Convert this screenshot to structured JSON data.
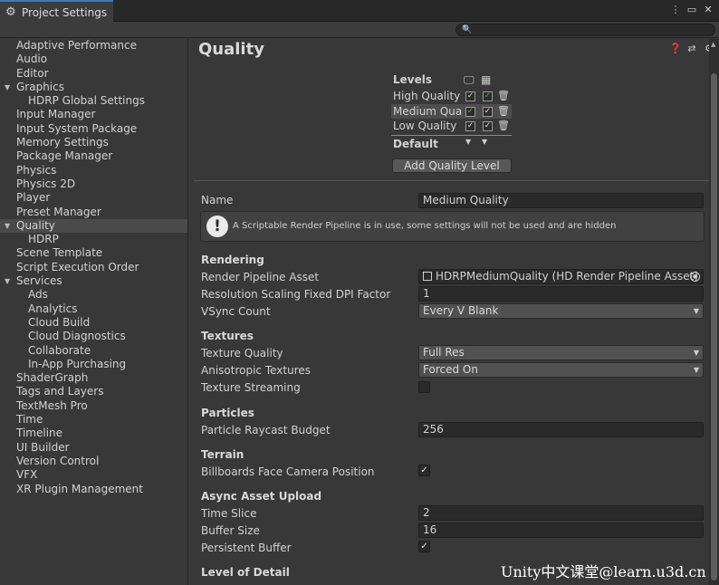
{
  "window": {
    "tab_icon": "gear-icon",
    "tab_title": "Project Settings",
    "buttons": [
      "more-icon",
      "maximize-icon",
      "close-icon"
    ]
  },
  "search": {
    "placeholder": ""
  },
  "sidebar": {
    "items": [
      {
        "label": "Adaptive Performance",
        "level": 0
      },
      {
        "label": "Audio",
        "level": 0
      },
      {
        "label": "Editor",
        "level": 0
      },
      {
        "label": "Graphics",
        "level": 0,
        "expanded": true
      },
      {
        "label": "HDRP Global Settings",
        "level": 1
      },
      {
        "label": "Input Manager",
        "level": 0
      },
      {
        "label": "Input System Package",
        "level": 0
      },
      {
        "label": "Memory Settings",
        "level": 0
      },
      {
        "label": "Package Manager",
        "level": 0
      },
      {
        "label": "Physics",
        "level": 0
      },
      {
        "label": "Physics 2D",
        "level": 0
      },
      {
        "label": "Player",
        "level": 0
      },
      {
        "label": "Preset Manager",
        "level": 0
      },
      {
        "label": "Quality",
        "level": 0,
        "expanded": true,
        "selected": true
      },
      {
        "label": "HDRP",
        "level": 1
      },
      {
        "label": "Scene Template",
        "level": 0
      },
      {
        "label": "Script Execution Order",
        "level": 0
      },
      {
        "label": "Services",
        "level": 0,
        "expanded": true
      },
      {
        "label": "Ads",
        "level": 1
      },
      {
        "label": "Analytics",
        "level": 1
      },
      {
        "label": "Cloud Build",
        "level": 1
      },
      {
        "label": "Cloud Diagnostics",
        "level": 1
      },
      {
        "label": "Collaborate",
        "level": 1
      },
      {
        "label": "In-App Purchasing",
        "level": 1
      },
      {
        "label": "ShaderGraph",
        "level": 0
      },
      {
        "label": "Tags and Layers",
        "level": 0
      },
      {
        "label": "TextMesh Pro",
        "level": 0
      },
      {
        "label": "Time",
        "level": 0
      },
      {
        "label": "Timeline",
        "level": 0
      },
      {
        "label": "UI Builder",
        "level": 0
      },
      {
        "label": "Version Control",
        "level": 0
      },
      {
        "label": "VFX",
        "level": 0
      },
      {
        "label": "XR Plugin Management",
        "level": 0
      }
    ]
  },
  "main": {
    "title": "Quality",
    "header_icons": [
      "help-icon",
      "preset-icon",
      "settings-icon"
    ],
    "levels": {
      "label": "Levels",
      "rows": [
        {
          "name": "High Quality",
          "desktop": true,
          "desktop_green": false,
          "standalone": true,
          "standalone_green": true
        },
        {
          "name": "Medium Quality",
          "desktop": true,
          "desktop_green": true,
          "standalone": true,
          "standalone_green": false,
          "selected": true
        },
        {
          "name": "Low Quality",
          "desktop": true,
          "desktop_green": false,
          "standalone": true,
          "standalone_green": false
        }
      ],
      "default_label": "Default"
    },
    "add_button": "Add Quality Level",
    "name_label": "Name",
    "name_value": "Medium Quality",
    "help_text": "A Scriptable Render Pipeline is in use, some settings will not be used and are hidden",
    "rendering": {
      "heading": "Rendering",
      "pipeline_label": "Render Pipeline Asset",
      "pipeline_value": "HDRPMediumQuality (HD Render Pipeline Asset)",
      "dpi_label": "Resolution Scaling Fixed DPI Factor",
      "dpi_value": "1",
      "vsync_label": "VSync Count",
      "vsync_value": "Every V Blank"
    },
    "textures": {
      "heading": "Textures",
      "quality_label": "Texture Quality",
      "quality_value": "Full Res",
      "aniso_label": "Anisotropic Textures",
      "aniso_value": "Forced On",
      "streaming_label": "Texture Streaming",
      "streaming_checked": false
    },
    "particles": {
      "heading": "Particles",
      "raycast_label": "Particle Raycast Budget",
      "raycast_value": "256"
    },
    "terrain": {
      "heading": "Terrain",
      "billboard_label": "Billboards Face Camera Position",
      "billboard_checked": true
    },
    "async": {
      "heading": "Async Asset Upload",
      "slice_label": "Time Slice",
      "slice_value": "2",
      "buffer_label": "Buffer Size",
      "buffer_value": "16",
      "persistent_label": "Persistent Buffer",
      "persistent_checked": true
    },
    "lod": {
      "heading": "Level of Detail"
    }
  },
  "watermark": "Unity中文课堂@learn.u3d.cn"
}
